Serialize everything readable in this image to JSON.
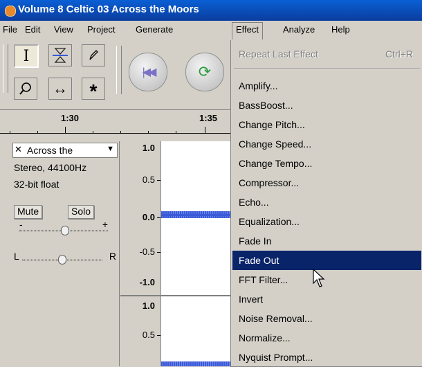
{
  "window": {
    "title": "Volume 8 Celtic 03 Across the Moors"
  },
  "menubar": {
    "items": [
      "File",
      "Edit",
      "View",
      "Project",
      "Generate",
      "Effect",
      "Analyze",
      "Help"
    ],
    "open": "Effect"
  },
  "ruler": {
    "labels": [
      "1:30",
      "1:35"
    ]
  },
  "track": {
    "name": "Across the",
    "format": "Stereo, 44100Hz",
    "bitdepth": "32-bit float",
    "mute_label": "Mute",
    "solo_label": "Solo",
    "gain_minus": "-",
    "gain_plus": "+",
    "pan_left": "L",
    "pan_right": "R"
  },
  "vscale": {
    "upper": [
      "1.0",
      "0.5",
      "0.0",
      "-0.5",
      "-1.0"
    ],
    "lower": [
      "1.0",
      "0.5"
    ]
  },
  "effect_menu": {
    "repeat_label": "Repeat Last Effect",
    "repeat_shortcut": "Ctrl+R",
    "items": [
      "Amplify...",
      "BassBoost...",
      "Change Pitch...",
      "Change Speed...",
      "Change Tempo...",
      "Compressor...",
      "Echo...",
      "Equalization...",
      "Fade In",
      "Fade Out",
      "FFT Filter...",
      "Invert",
      "Noise Removal...",
      "Normalize...",
      "Nyquist Prompt..."
    ],
    "highlighted": "Fade Out"
  },
  "colors": {
    "titlebar": "#0a3d9e",
    "highlight": "#0a246a",
    "waveform": "#3a5ad8"
  },
  "icons": {
    "select_tool": "i-beam-icon",
    "envelope_tool": "envelope-icon",
    "draw_tool": "pencil-icon",
    "zoom_tool": "magnifier-icon",
    "timeshift_tool": "double-arrow-icon",
    "multi_tool": "asterisk-icon",
    "skip_start": "skip-to-start-icon",
    "loop": "loop-icon"
  }
}
